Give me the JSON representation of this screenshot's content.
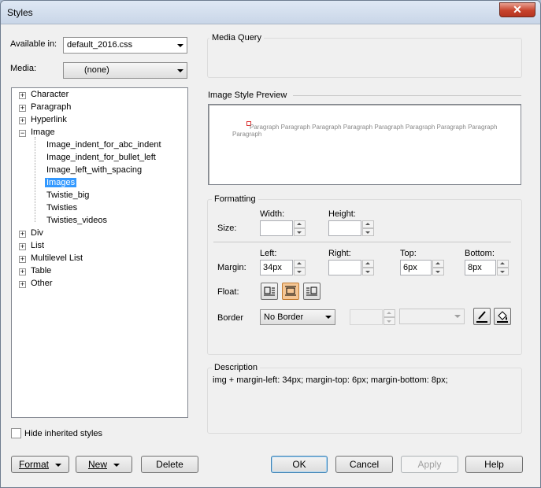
{
  "window": {
    "title": "Styles",
    "close_glyph": "✕"
  },
  "left": {
    "available_label": "Available in:",
    "available_value": "default_2016.css",
    "media_label": "Media:",
    "media_value": "(none)",
    "tree": {
      "items": [
        "Character",
        "Paragraph",
        "Hyperlink",
        "Image",
        "Div",
        "List",
        "Multilevel List",
        "Table",
        "Other"
      ],
      "image_children": [
        "Image_indent_for_abc_indent",
        "Image_indent_for_bullet_left",
        "Image_left_with_spacing",
        "Images",
        "Twistie_big",
        "Twisties",
        "Twisties_videos"
      ],
      "collapsed_glyph": "+",
      "expanded_glyph": "−"
    },
    "hide_inherited_label": "Hide inherited styles"
  },
  "media_query": {
    "title": "Media Query"
  },
  "preview": {
    "title": "Image Style Preview",
    "text": "Paragraph Paragraph Paragraph Paragraph Paragraph Paragraph Paragraph Paragraph",
    "text_wrap": "Paragraph"
  },
  "formatting": {
    "title": "Formatting",
    "size_label": "Size:",
    "width_label": "Width:",
    "height_label": "Height:",
    "margin_label": "Margin:",
    "left_label": "Left:",
    "right_label": "Right:",
    "top_label": "Top:",
    "bottom_label": "Bottom:",
    "left_value": "34px",
    "top_value": "6px",
    "bottom_value": "8px",
    "float_label": "Float:",
    "border_label": "Border",
    "border_value": "No Border"
  },
  "description": {
    "title": "Description",
    "text": "img + margin-left: 34px;  margin-top: 6px;  margin-bottom: 8px;"
  },
  "buttons": {
    "format": "Format",
    "new": "New",
    "delete": "Delete",
    "ok": "OK",
    "cancel": "Cancel",
    "apply": "Apply",
    "help": "Help"
  },
  "colors": {
    "selection": "#3399ff",
    "float_active": "#f5c694",
    "close_button": "#c7432c"
  }
}
